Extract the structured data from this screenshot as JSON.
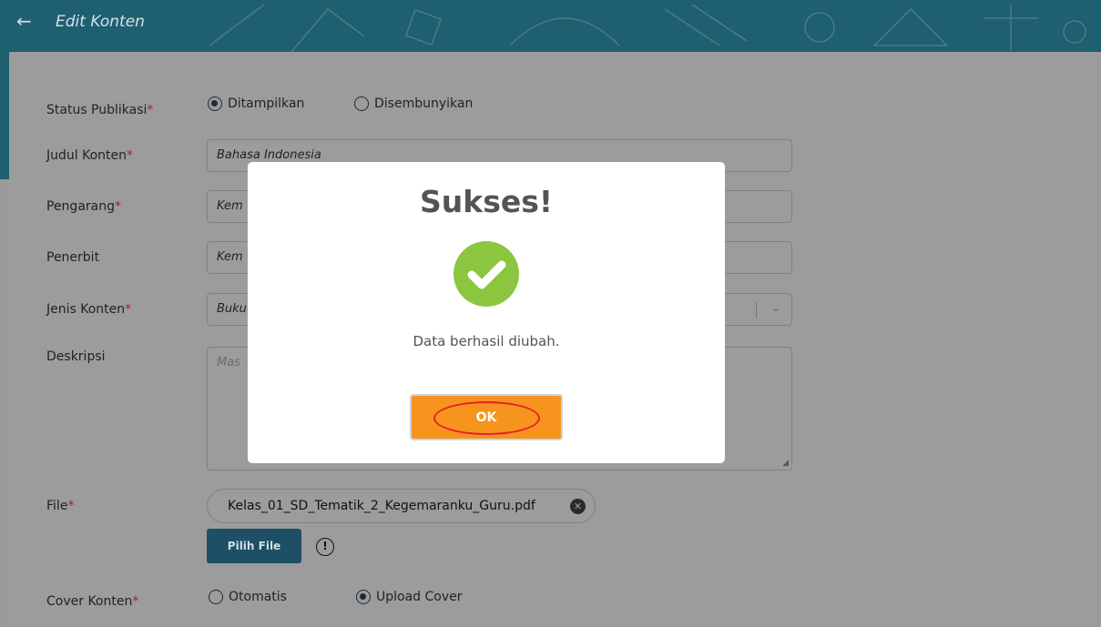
{
  "header": {
    "title": "Edit Konten"
  },
  "form": {
    "status_label": "Status Publikasi",
    "status_options": [
      "Ditampilkan",
      "Disembunyikan"
    ],
    "judul_label": "Judul Konten",
    "judul_value": "Bahasa Indonesia",
    "pengarang_label": "Pengarang",
    "pengarang_value": "Kem",
    "penerbit_label": "Penerbit",
    "penerbit_value": "Kem",
    "jenis_label": "Jenis Konten",
    "jenis_value": "Buku",
    "deskripsi_label": "Deskripsi",
    "deskripsi_placeholder": "Mas",
    "file_label": "File",
    "file_name": "Kelas_01_SD_Tematik_2_Kegemaranku_Guru.pdf",
    "pick_file_label": "Pilih File",
    "info_glyph": "!",
    "cover_label": "Cover Konten",
    "cover_options": [
      "Otomatis",
      "Upload Cover"
    ],
    "required_mark": "*"
  },
  "modal": {
    "title": "Sukses!",
    "message": "Data berhasil diubah.",
    "ok_label": "OK"
  },
  "colors": {
    "header": "#1e5f70",
    "ok_button": "#f7941d",
    "success_check": "#8cc63f",
    "highlight_ring": "#e8202a"
  }
}
